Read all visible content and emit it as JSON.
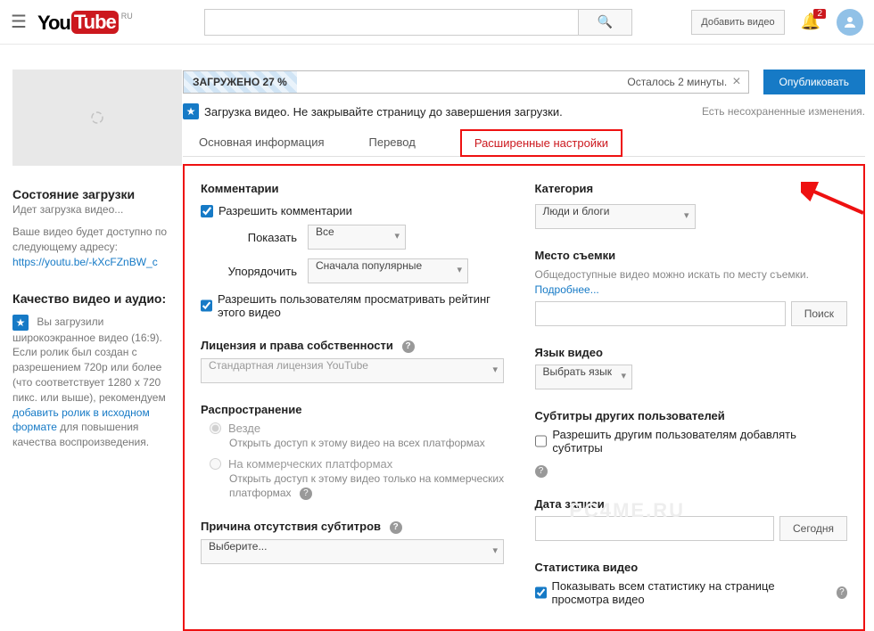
{
  "header": {
    "logo_you": "You",
    "logo_tube": "Tube",
    "region": "RU",
    "search_placeholder": "",
    "add_video": "Добавить видео",
    "bell_count": "2"
  },
  "sidebar": {
    "status_heading": "Состояние загрузки",
    "status_sub": "Идет загрузка видео...",
    "avail_text": "Ваше видео будет доступно по следующему адресу:",
    "url": "https://youtu.be/-kXcFZnBW_c",
    "quality_heading": "Качество видео и аудио:",
    "quality_text_1": "Вы загрузили широкоэкранное видео (16:9). Если ролик был создан с разрешением 720p или более (что соответствует 1280 x 720 пикс. или выше), рекомендуем ",
    "quality_link": "добавить ролик в исходном формате",
    "quality_text_2": " для повышения качества воспроизведения."
  },
  "progress": {
    "label": "ЗАГРУЖЕНО 27 %",
    "remaining": "Осталось 2 минуты.",
    "publish": "Опубликовать"
  },
  "status": {
    "msg": "Загрузка видео. Не закрывайте страницу до завершения загрузки.",
    "unsaved": "Есть несохраненные изменения."
  },
  "tabs": {
    "basic": "Основная информация",
    "translate": "Перевод",
    "advanced": "Расширенные настройки"
  },
  "left": {
    "comments_h": "Комментарии",
    "allow_comments": "Разрешить комментарии",
    "show_label": "Показать",
    "show_value": "Все",
    "sort_label": "Упорядочить",
    "sort_value": "Сначала популярные",
    "allow_rating": "Разрешить пользователям просматривать рейтинг этого видео",
    "license_h": "Лицензия и права собственности",
    "license_value": "Стандартная лицензия YouTube",
    "distribution_h": "Распространение",
    "dist_everywhere": "Везде",
    "dist_everywhere_desc": "Открыть доступ к этому видео на всех платформах",
    "dist_commercial": "На коммерческих платформах",
    "dist_commercial_desc": "Открыть доступ к этому видео только на коммерческих платформах",
    "subs_reason_h": "Причина отсутствия субтитров",
    "subs_reason_value": "Выберите..."
  },
  "right": {
    "category_h": "Категория",
    "category_value": "Люди и блоги",
    "location_h": "Место съемки",
    "location_hint": "Общедоступные видео можно искать по месту съемки.",
    "location_more": "Подробнее...",
    "search_btn": "Поиск",
    "lang_h": "Язык видео",
    "lang_value": "Выбрать язык",
    "community_subs_h": "Субтитры других пользователей",
    "community_subs_chk": "Разрешить другим пользователям добавлять субтитры",
    "date_h": "Дата записи",
    "today_btn": "Сегодня",
    "stats_h": "Статистика видео",
    "stats_chk": "Показывать всем статистику на странице просмотра видео"
  },
  "watermark": "PC4ME.RU"
}
